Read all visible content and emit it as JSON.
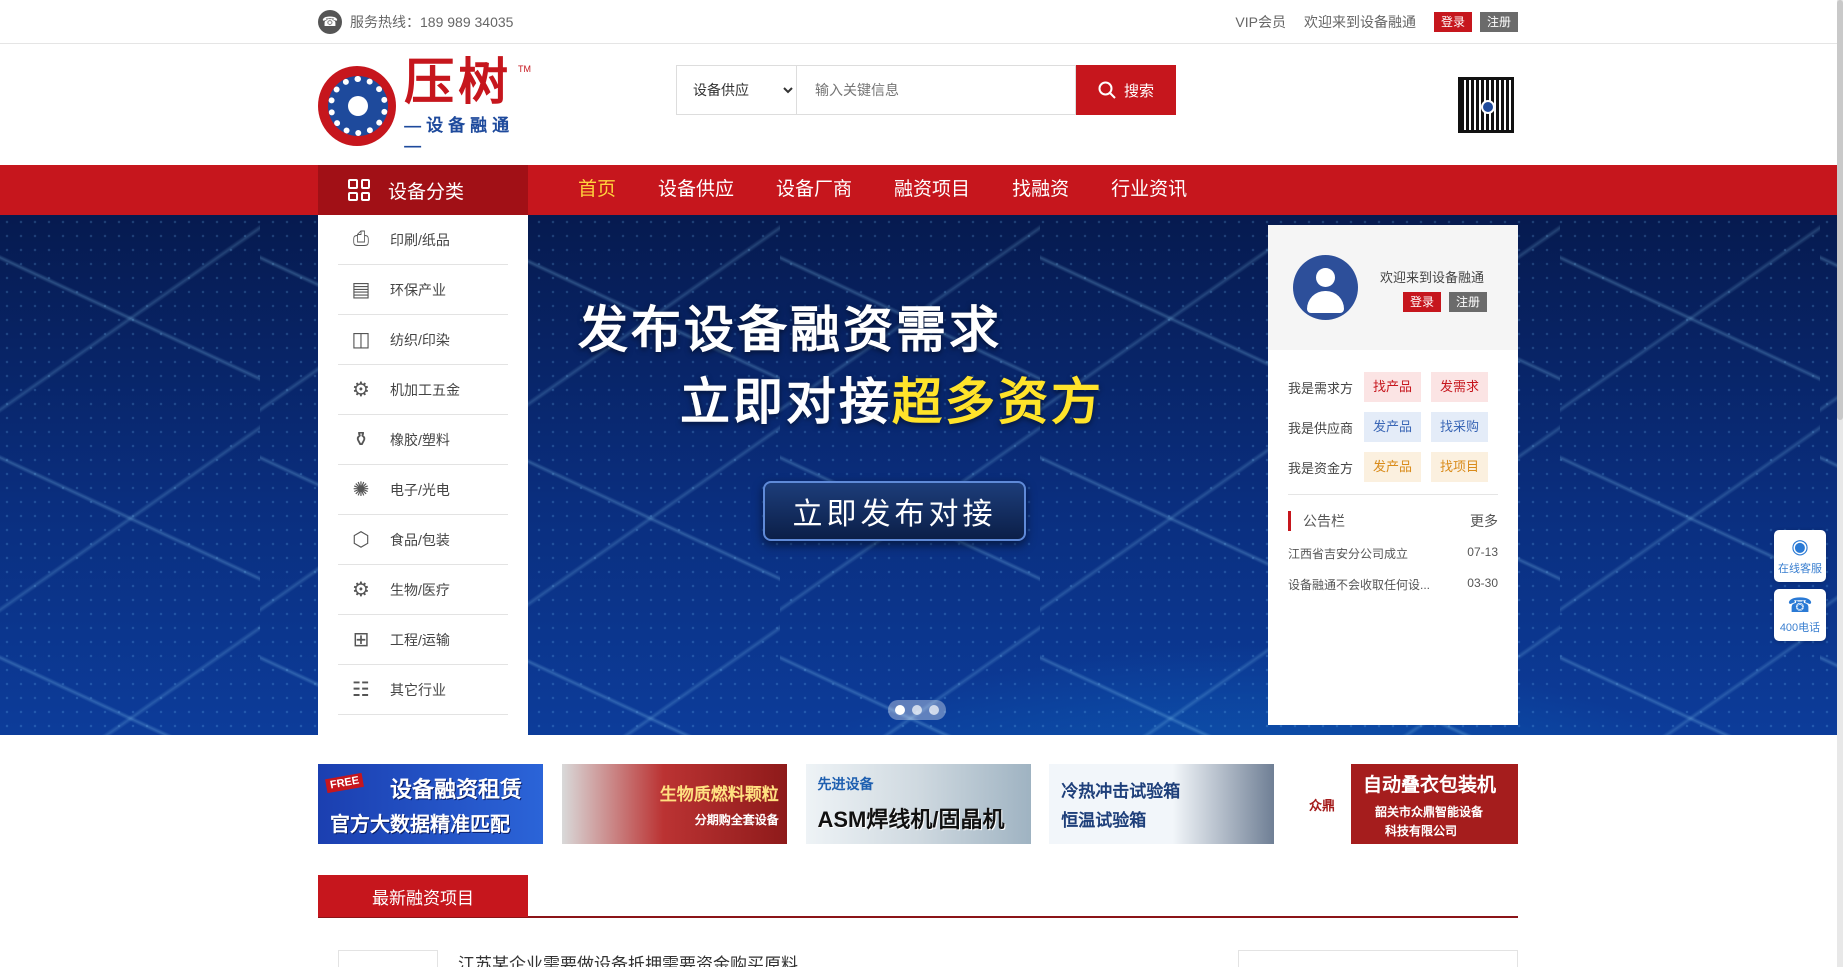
{
  "topbar": {
    "hotline": "服务热线：189 989 34035",
    "vip": "VIP会员",
    "welcome": "欢迎来到设备融通",
    "login": "登录",
    "register": "注册"
  },
  "logo": {
    "main": "压树",
    "sub": "—设备融通—",
    "tm": "TM"
  },
  "search": {
    "category": "设备供应",
    "placeholder": "输入关键信息",
    "button": "搜索"
  },
  "nav": {
    "category_title": "设备分类",
    "items": [
      "首页",
      "设备供应",
      "设备厂商",
      "融资项目",
      "找融资",
      "行业资讯"
    ]
  },
  "categories": [
    {
      "label": "印刷/纸品",
      "icon": "printer-icon"
    },
    {
      "label": "环保产业",
      "icon": "document-icon"
    },
    {
      "label": "纺织/印染",
      "icon": "book-icon"
    },
    {
      "label": "机加工五金",
      "icon": "gear-icon"
    },
    {
      "label": "橡胶/塑料",
      "icon": "bottle-icon"
    },
    {
      "label": "电子/光电",
      "icon": "bulb-icon"
    },
    {
      "label": "食品/包装",
      "icon": "box-icon"
    },
    {
      "label": "生物/医疗",
      "icon": "gear-icon"
    },
    {
      "label": "工程/运输",
      "icon": "grid-icon"
    },
    {
      "label": "其它行业",
      "icon": "stack-icon"
    }
  ],
  "banner": {
    "line1": "发布设备融资需求",
    "line2_prefix": "立即对接",
    "line2_highlight": "超多资方",
    "cta": "立即发布对接"
  },
  "panel": {
    "welcome": "欢迎来到设备融通",
    "login": "登录",
    "register": "注册",
    "roles": [
      {
        "label": "我是需求方",
        "a": "找产品",
        "b": "发需求"
      },
      {
        "label": "我是供应商",
        "a": "发产品",
        "b": "找采购"
      },
      {
        "label": "我是资金方",
        "a": "发产品",
        "b": "找项目"
      }
    ],
    "notice_title": "公告栏",
    "more": "更多",
    "notices": [
      {
        "text": "江西省吉安分公司成立",
        "date": "07-13"
      },
      {
        "text": "设备融通不会收取任何设...",
        "date": "03-30"
      }
    ]
  },
  "float": {
    "service": "在线客服",
    "phone": "400电话"
  },
  "ads": {
    "ad1": {
      "free": "FREE",
      "l1": "设备融资租赁",
      "l2": "官方大数据精准匹配"
    },
    "ad2": {
      "l1": "生物质燃料颗粒",
      "l2": "分期购全套设备"
    },
    "ad3": {
      "l1": "先进设备",
      "l2": "ASM焊线机/固晶机"
    },
    "ad4": {
      "l1": "冷热冲击试验箱",
      "l2": "恒温试验箱"
    },
    "ad5": {
      "seal": "众鼎",
      "l1": "自动叠衣包装机",
      "l2": "韶关市众鼎智能设备",
      "l3": "科技有限公司"
    }
  },
  "section": {
    "title": "最新融资项目",
    "first_project": "江苏某企业需要做设备抵押需要资金购买原料"
  }
}
